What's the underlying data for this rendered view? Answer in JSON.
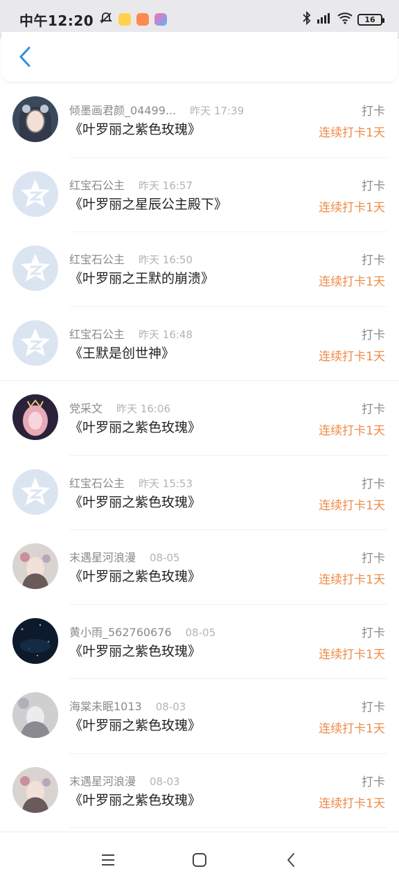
{
  "status_bar": {
    "time": "中午12:20",
    "battery": "16"
  },
  "records": [
    {
      "user": "倾墨画君颜_04499...",
      "time": "昨天 17:39",
      "title": "《叶罗丽之紫色玫瑰》",
      "kind": "打卡",
      "streak": "连续打卡1天",
      "avatar": "photo-dark-hair"
    },
    {
      "user": "红宝石公主",
      "time": "昨天 16:57",
      "title": "《叶罗丽之星辰公主殿下》",
      "kind": "打卡",
      "streak": "连续打卡1天",
      "avatar": "default-star"
    },
    {
      "user": "红宝石公主",
      "time": "昨天 16:50",
      "title": "《叶罗丽之王默的崩溃》",
      "kind": "打卡",
      "streak": "连续打卡1天",
      "avatar": "default-star"
    },
    {
      "user": "红宝石公主",
      "time": "昨天 16:48",
      "title": "《王默是创世神》",
      "kind": "打卡",
      "streak": "连续打卡1天",
      "avatar": "default-star"
    },
    {
      "user": "党采文",
      "time": "昨天 16:06",
      "title": "《叶罗丽之紫色玫瑰》",
      "kind": "打卡",
      "streak": "连续打卡1天",
      "avatar": "photo-pink-hair"
    },
    {
      "user": "红宝石公主",
      "time": "昨天 15:53",
      "title": "《叶罗丽之紫色玫瑰》",
      "kind": "打卡",
      "streak": "连续打卡1天",
      "avatar": "default-star"
    },
    {
      "user": "末遇星河浪漫",
      "time": "08-05",
      "title": "《叶罗丽之紫色玫瑰》",
      "kind": "打卡",
      "streak": "连续打卡1天",
      "avatar": "photo-light"
    },
    {
      "user": "黄小雨_562760676",
      "time": "08-05",
      "title": "《叶罗丽之紫色玫瑰》",
      "kind": "打卡",
      "streak": "连续打卡1天",
      "avatar": "photo-night"
    },
    {
      "user": "海棠未眠1013",
      "time": "08-03",
      "title": "《叶罗丽之紫色玫瑰》",
      "kind": "打卡",
      "streak": "连续打卡1天",
      "avatar": "photo-grey"
    },
    {
      "user": "末遇星河浪漫",
      "time": "08-03",
      "title": "《叶罗丽之紫色玫瑰》",
      "kind": "打卡",
      "streak": "连续打卡1天",
      "avatar": "photo-light"
    }
  ],
  "colors": {
    "accent": "#f08a46",
    "back_arrow": "#2f8fe0",
    "default_avatar": "#dbe5f2"
  }
}
